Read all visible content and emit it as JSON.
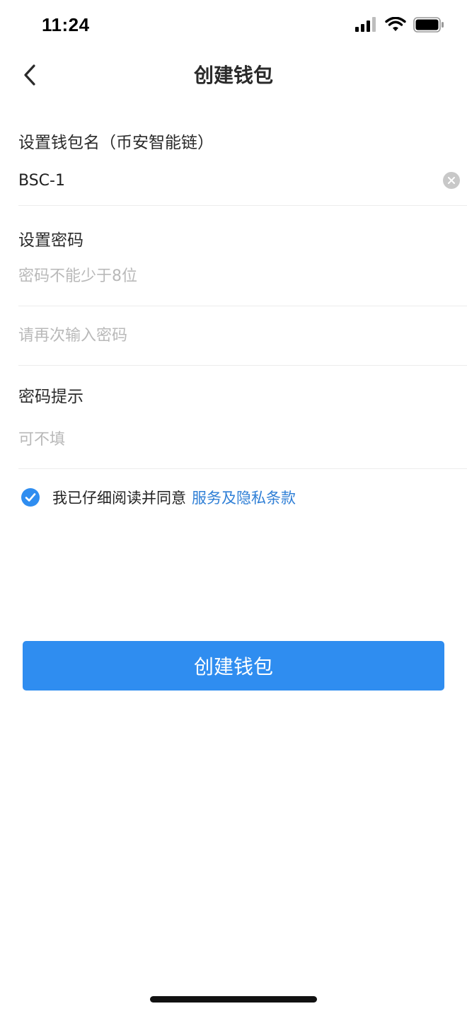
{
  "status_bar": {
    "time": "11:24",
    "icons": [
      "cellular-signal-icon",
      "wifi-icon",
      "battery-icon"
    ]
  },
  "nav": {
    "back_icon": "chevron-left-icon",
    "title": "创建钱包"
  },
  "form": {
    "wallet_name_label": "设置钱包名（币安智能链）",
    "wallet_name_value": "BSC-1",
    "clear_icon": "clear-x-icon",
    "password_label": "设置密码",
    "password_placeholder": "密码不能少于8位",
    "password_confirm_placeholder": "请再次输入密码",
    "hint_label": "密码提示",
    "hint_placeholder": "可不填"
  },
  "agreement": {
    "checked": true,
    "text": "我已仔细阅读并同意",
    "link": "服务及隐私条款"
  },
  "actions": {
    "create_button": "创建钱包"
  },
  "colors": {
    "accent": "#2f8df0",
    "link": "#2f7fd6",
    "placeholder": "#b9b9b9",
    "divider": "#ececec"
  }
}
